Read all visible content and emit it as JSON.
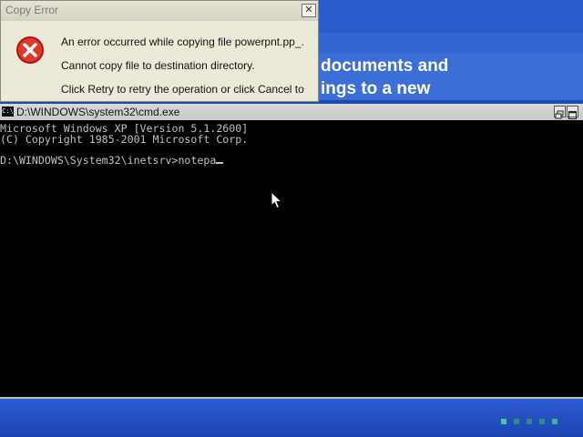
{
  "background": {
    "banner_text": "documents and\nings to a new"
  },
  "dialog": {
    "title": "Copy Error",
    "close_glyph": "✕",
    "lines": [
      "An error occurred while copying file powerpnt.pp_.",
      "Cannot copy file to destination directory.",
      "Click Retry to retry the operation or click Cancel to"
    ],
    "icon": "error-icon"
  },
  "cmd": {
    "title": "D:\\WINDOWS\\system32\\cmd.exe",
    "app_icon_glyph": "C:\\",
    "lines": [
      "Microsoft Windows XP [Version 5.1.2600]",
      "(C) Copyright 1985-2001 Microsoft Corp.",
      "",
      "D:\\WINDOWS\\System32\\inetsrv>notepa"
    ]
  },
  "colors": {
    "desktop": "#1f49b5",
    "console_text": "#c0c0c0",
    "error_red": "#d9261c"
  }
}
